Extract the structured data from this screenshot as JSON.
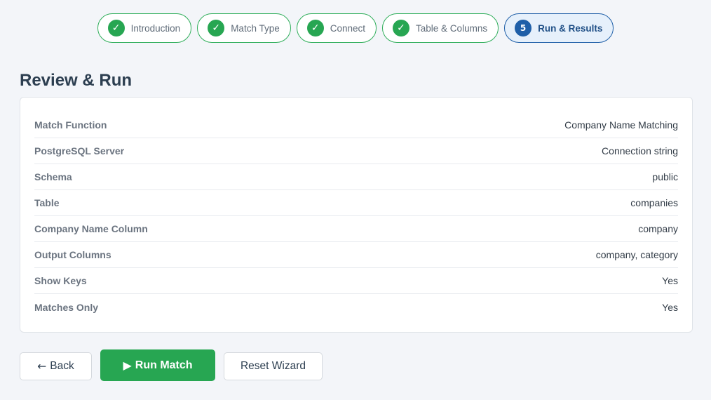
{
  "wizard": {
    "steps": [
      {
        "label": "Introduction",
        "badge": "✓"
      },
      {
        "label": "Match Type",
        "badge": "✓"
      },
      {
        "label": "Connect",
        "badge": "✓"
      },
      {
        "label": "Table & Columns",
        "badge": "✓"
      },
      {
        "label": "Run & Results",
        "badge": "5"
      }
    ],
    "active_step": 5
  },
  "page": {
    "title": "Review & Run"
  },
  "summary": {
    "rows": [
      {
        "label": "Match Function",
        "value": "Company Name Matching"
      },
      {
        "label": "PostgreSQL Server",
        "value": "Connection string"
      },
      {
        "label": "Schema",
        "value": "public"
      },
      {
        "label": "Table",
        "value": "companies"
      },
      {
        "label": "Company Name Column",
        "value": "company"
      },
      {
        "label": "Output Columns",
        "value": "company, category"
      },
      {
        "label": "Show Keys",
        "value": "Yes"
      },
      {
        "label": "Matches Only",
        "value": "Yes"
      }
    ]
  },
  "actions": {
    "back_icon": "←",
    "back_label": "Back",
    "run_icon": "▶",
    "run_label": "Run Match",
    "reset_label": "Reset Wizard"
  },
  "colors": {
    "success": "#27a652",
    "active": "#1f5fa8",
    "background": "#f3f5f9"
  }
}
